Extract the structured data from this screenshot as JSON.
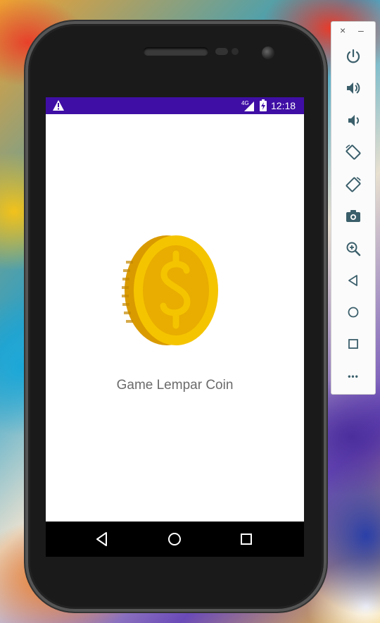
{
  "status_bar": {
    "time": "12:18",
    "network": "4G"
  },
  "app": {
    "title": "Game Lempar Coin",
    "logo": "coin-dollar-icon"
  },
  "colors": {
    "status_bar": "#3f0ea5",
    "coin_face": "#f5c400",
    "coin_inner": "#e8ad00",
    "coin_edge": "#d99a00",
    "title_text": "#6b6b6b"
  },
  "nav_bar": {
    "buttons": [
      "back-icon",
      "home-icon",
      "recents-icon"
    ]
  },
  "emulator_toolbar": {
    "window_controls": {
      "close": "×",
      "minimize": "–"
    },
    "buttons": [
      "power-icon",
      "volume-up-icon",
      "volume-down-icon",
      "rotate-left-icon",
      "rotate-right-icon",
      "camera-icon",
      "zoom-icon",
      "back-icon",
      "home-icon",
      "overview-icon",
      "more-icon"
    ],
    "more_label": "•••"
  }
}
